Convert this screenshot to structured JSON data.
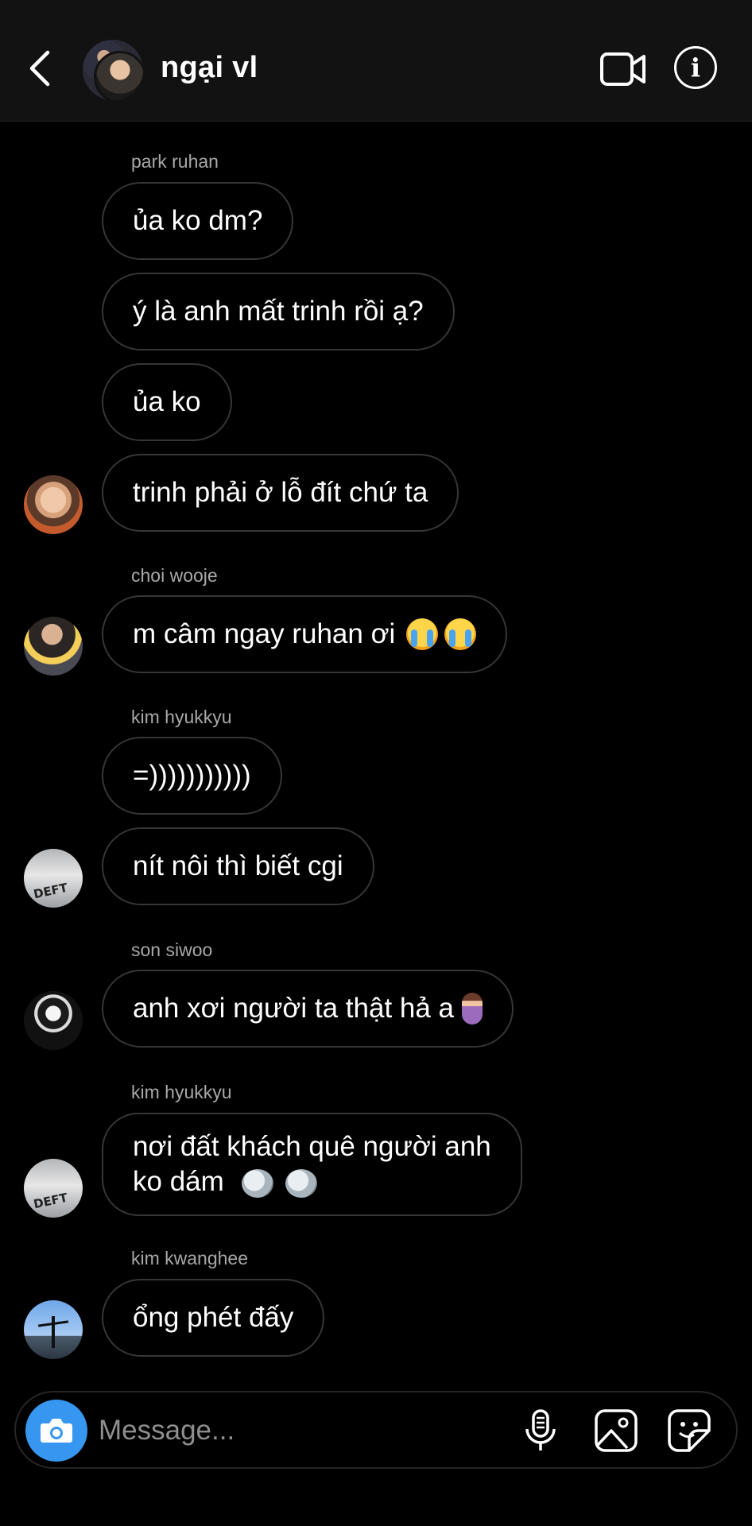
{
  "header": {
    "title": "ngại vl"
  },
  "messages": [
    {
      "sender": "park ruhan",
      "text": "ủa ko dm?"
    },
    {
      "text": "ý là anh mất trinh rồi ạ?"
    },
    {
      "text": "ủa ko"
    },
    {
      "text": "trinh phải ở lỗ đít chứ ta"
    },
    {
      "sender": "choi wooje",
      "text": "m câm ngay ruhan ơi",
      "emoji": "loudly-crying-face"
    },
    {
      "sender": "kim hyukkyu",
      "text": "=)))))))))))"
    },
    {
      "text": "nít nôi thì biết cgi"
    },
    {
      "sender": "son siwoo",
      "text": "anh xơi người ta thật hả a",
      "emoji": "pregnant-woman"
    },
    {
      "sender": "kim hyukkyu",
      "text_line1": "nơi đất khách quê người anh",
      "text_line2": "ko dám",
      "emoji": "bird"
    },
    {
      "sender": "kim kwanghee",
      "text": "ổng phét đấy"
    }
  ],
  "avatars": {
    "deft_label": "DEFT"
  },
  "composer": {
    "placeholder": "Message..."
  },
  "colors": {
    "background": "#000000",
    "header": "#121212",
    "camera_button": "#3797f0",
    "bubble_border": "#363636"
  }
}
